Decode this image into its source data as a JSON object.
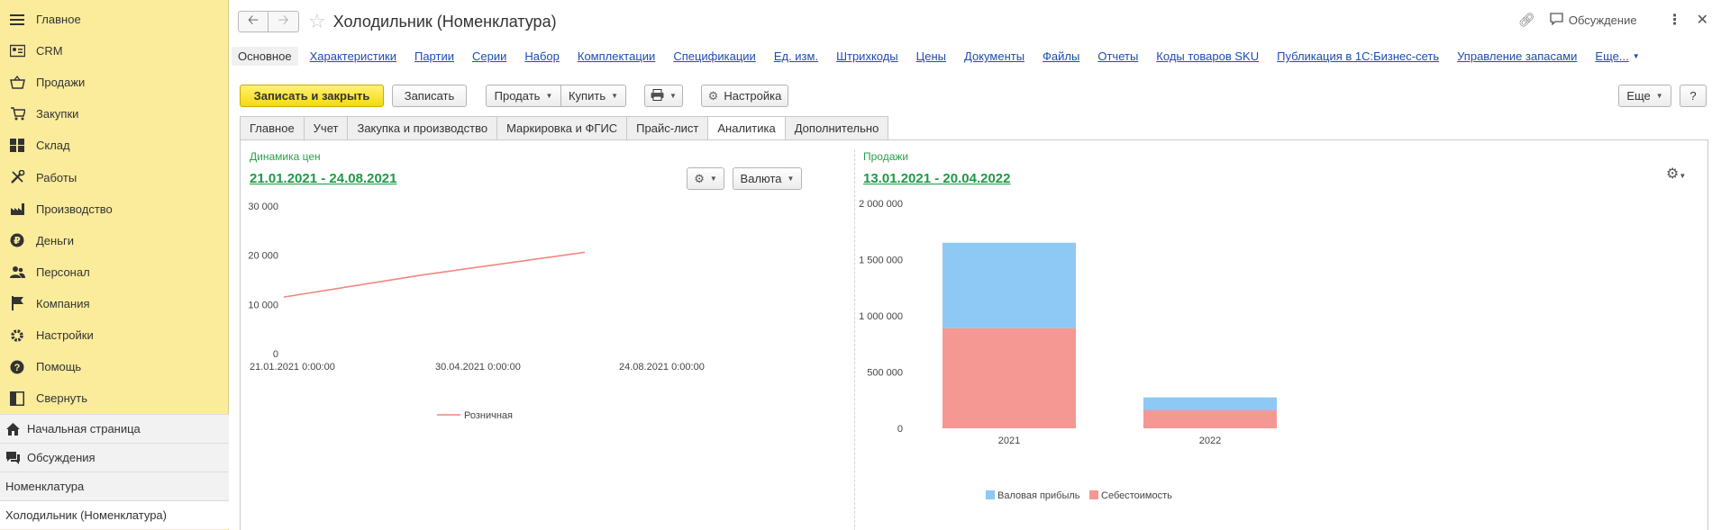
{
  "sidebar": {
    "items": [
      {
        "label": "Главное",
        "icon": "menu-icon"
      },
      {
        "label": "CRM",
        "icon": "crm-icon"
      },
      {
        "label": "Продажи",
        "icon": "sales-icon"
      },
      {
        "label": "Закупки",
        "icon": "purchases-icon"
      },
      {
        "label": "Склад",
        "icon": "warehouse-icon"
      },
      {
        "label": "Работы",
        "icon": "tools-icon"
      },
      {
        "label": "Производство",
        "icon": "factory-icon"
      },
      {
        "label": "Деньги",
        "icon": "money-icon"
      },
      {
        "label": "Персонал",
        "icon": "people-icon"
      },
      {
        "label": "Компания",
        "icon": "flag-icon"
      },
      {
        "label": "Настройки",
        "icon": "gear-icon"
      },
      {
        "label": "Помощь",
        "icon": "help-icon"
      },
      {
        "label": "Свернуть",
        "icon": "collapse-icon"
      }
    ],
    "bottom": [
      {
        "label": "Начальная страница",
        "icon": "home-icon"
      },
      {
        "label": "Обсуждения",
        "icon": "chat-icon"
      },
      {
        "label": "Номенклатура",
        "icon": ""
      },
      {
        "label": "Холодильник (Номенклатура)",
        "icon": ""
      }
    ]
  },
  "header": {
    "title": "Холодильник (Номенклатура)",
    "discussion_label": "Обсуждение"
  },
  "links": [
    "Основное",
    "Характеристики",
    "Партии",
    "Серии",
    "Набор",
    "Комплектации",
    "Спецификации",
    "Ед. изм.",
    "Штрихкоды",
    "Цены",
    "Документы",
    "Файлы",
    "Отчеты",
    "Коды товаров SKU",
    "Публикация в 1С:Бизнес-сеть",
    "Управление запасами",
    "Еще..."
  ],
  "toolbar": {
    "save_close": "Записать и закрыть",
    "save": "Записать",
    "sell": "Продать",
    "buy": "Купить",
    "settings": "Настройка",
    "more": "Еще",
    "help": "?"
  },
  "tabs": [
    "Главное",
    "Учет",
    "Закупка и производство",
    "Маркировка и ФГИС",
    "Прайс-лист",
    "Аналитика",
    "Дополнительно"
  ],
  "left_panel": {
    "title": "Динамика  цен",
    "range": "21.01.2021 - 24.08.2021",
    "currency_label": "Валюта"
  },
  "right_panel": {
    "title": "Продажи",
    "range": "13.01.2021 - 20.04.2022"
  },
  "chart_data": [
    {
      "type": "line",
      "yticks": [
        "30 000",
        "20 000",
        "10 000",
        "0"
      ],
      "ylim": [
        0,
        30000
      ],
      "xticks": [
        "21.01.2021 0:00:00",
        "30.04.2021 0:00:00",
        "24.08.2021 0:00:00"
      ],
      "series": [
        {
          "name": "Розничная",
          "color": "#f4857d",
          "points": [
            [
              "2021-01-21",
              11500
            ],
            [
              "2021-04-30",
              16000
            ],
            [
              "2021-08-24",
              20600
            ]
          ]
        }
      ],
      "legend_position": "bottom",
      "grid": false
    },
    {
      "type": "bar",
      "stacked": true,
      "categories": [
        "2021",
        "2022"
      ],
      "yticks": [
        "2 000 000",
        "1 500 000",
        "1 000 000",
        "500 000",
        "0"
      ],
      "ylim": [
        0,
        2000000
      ],
      "series": [
        {
          "name": "Себестоимость",
          "color": "#f59893",
          "values": [
            890000,
            160000
          ]
        },
        {
          "name": "Валовая прибыль",
          "color": "#8ec8f5",
          "values": [
            760000,
            115000
          ]
        }
      ],
      "legend_order": [
        "Валовая прибыль",
        "Себестоимость"
      ],
      "legend_position": "bottom",
      "grid": false
    }
  ]
}
